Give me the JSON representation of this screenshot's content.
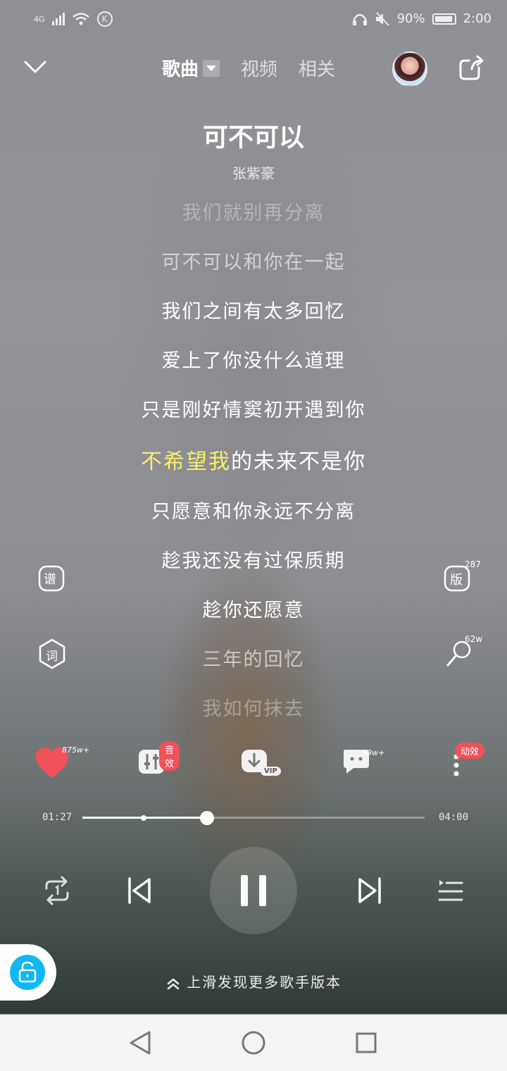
{
  "status_bar": {
    "network": "4G",
    "battery": "90%",
    "time": "2:00",
    "k_icon": "K"
  },
  "header": {
    "tabs": [
      {
        "label": "歌曲",
        "active": true
      },
      {
        "label": "视频"
      },
      {
        "label": "相关"
      }
    ]
  },
  "song": {
    "title": "可不可以",
    "artist": "张紫豪"
  },
  "lyrics": {
    "lines": [
      "我们就别再分离",
      "可不可以和你在一起",
      "我们之间有太多回忆",
      "爱上了你没什么道理",
      "只是刚好情窦初开遇到你"
    ],
    "current_sung": "不希望我",
    "current_rest": "的未来不是你",
    "after": [
      "只愿意和你永远不分离",
      "趁我还没有过保质期",
      "趁你还愿意",
      "三年的回忆",
      "我如何抹去"
    ]
  },
  "side": {
    "score_label": "谱",
    "lyric_label": "词",
    "version_label": "版",
    "version_count": "287",
    "sing_count": "62w"
  },
  "actions": {
    "like_count": "875w+",
    "effect_badge": "音效",
    "vip_badge": "VIP",
    "comment_count": "99w+",
    "motion_badge": "动效"
  },
  "progress": {
    "current": "01:27",
    "total": "04:00",
    "played_fraction": 0.365,
    "marker_fraction": 0.18
  },
  "footer": {
    "swipe_hint": "上滑发现更多歌手版本"
  },
  "colors": {
    "highlight": "#f7ef6a",
    "like": "#f0525a",
    "lock": "#12b7f5"
  }
}
